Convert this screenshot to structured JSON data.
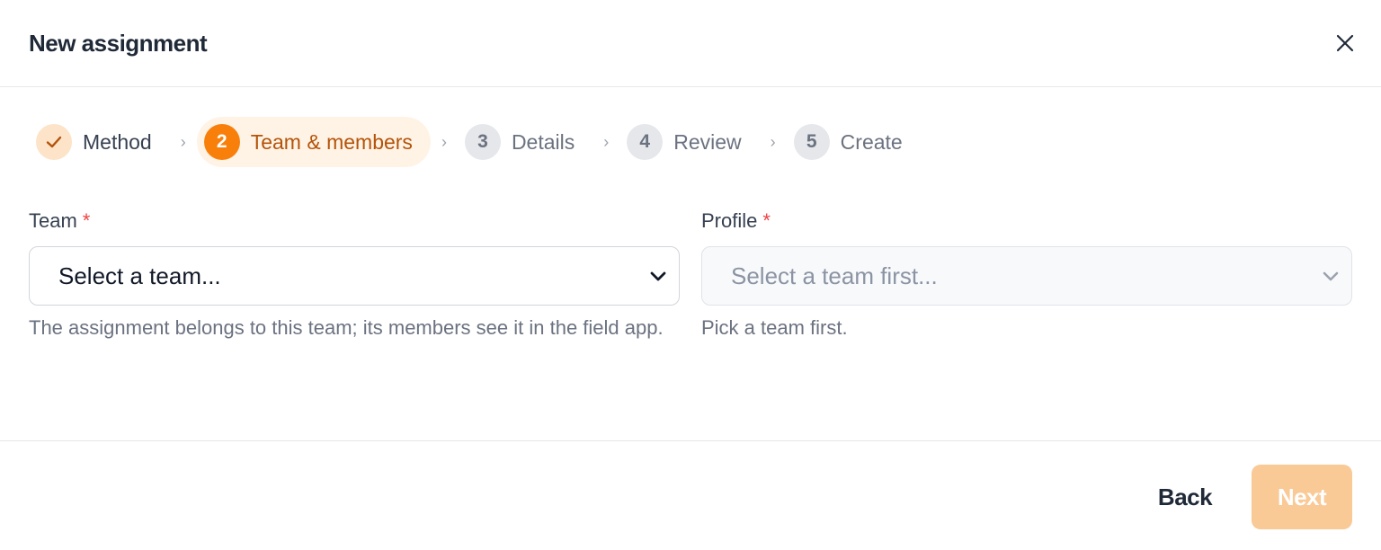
{
  "dialog": {
    "title": "New assignment",
    "close_icon": "close-icon"
  },
  "stepper": {
    "steps": [
      {
        "number": "1",
        "label": "Method",
        "state": "done",
        "icon": "check-icon"
      },
      {
        "number": "2",
        "label": "Team & members",
        "state": "current"
      },
      {
        "number": "3",
        "label": "Details",
        "state": "pending"
      },
      {
        "number": "4",
        "label": "Review",
        "state": "pending"
      },
      {
        "number": "5",
        "label": "Create",
        "state": "pending"
      }
    ],
    "separator_glyph": "›"
  },
  "form": {
    "team": {
      "label": "Team",
      "required_mark": "*",
      "value": "Select a team...",
      "help": "The assignment belongs to this team; its members see it in the field app."
    },
    "profile": {
      "label": "Profile",
      "required_mark": "*",
      "value": "Select a team first...",
      "disabled": true,
      "help": "Pick a team first."
    }
  },
  "footer": {
    "back_label": "Back",
    "next_label": "Next",
    "next_disabled": true
  },
  "colors": {
    "accent": "#f97f0b",
    "accent_soft": "#fff3e6",
    "next_disabled_bg": "#f9c996",
    "required": "#ef4444"
  }
}
